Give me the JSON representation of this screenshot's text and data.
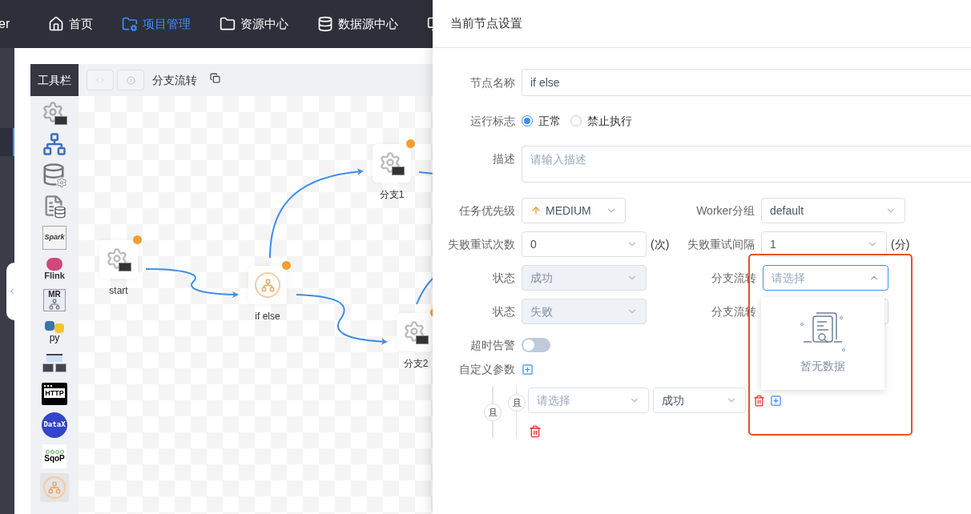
{
  "nav": {
    "logo_fragment": "er",
    "items": [
      {
        "label": "首页",
        "selected": false
      },
      {
        "label": "项目管理",
        "selected": true
      },
      {
        "label": "资源中心",
        "selected": false
      },
      {
        "label": "数据源中心",
        "selected": false
      }
    ]
  },
  "toolbar": {
    "title": "工具栏",
    "process_name": "分支流转"
  },
  "tools": [
    {
      "kind": "shell",
      "selected": false
    },
    {
      "kind": "subprocess",
      "selected": false
    },
    {
      "kind": "procedure",
      "selected": false
    },
    {
      "kind": "sql",
      "selected": false
    },
    {
      "kind": "spark",
      "label": "Spark",
      "selected": false
    },
    {
      "kind": "flink",
      "label": "Flink",
      "selected": false
    },
    {
      "kind": "mr",
      "label": "MR",
      "selected": false
    },
    {
      "kind": "python",
      "label": "py",
      "selected": false
    },
    {
      "kind": "dependent",
      "selected": false
    },
    {
      "kind": "http",
      "label": "HTTP",
      "selected": false
    },
    {
      "kind": "datax",
      "label": "DataX",
      "selected": false
    },
    {
      "kind": "sqoop",
      "label": "SqoP",
      "selected": false
    },
    {
      "kind": "conditions",
      "selected": true
    }
  ],
  "canvas": {
    "nodes": [
      {
        "label": "start",
        "kind": "shell"
      },
      {
        "label": "if else",
        "kind": "conditions"
      },
      {
        "label": "分支1",
        "kind": "shell"
      },
      {
        "label": "分支2",
        "kind": "shell"
      }
    ]
  },
  "drawer": {
    "title": "当前节点设置",
    "node_name": {
      "label": "节点名称",
      "value": "if else"
    },
    "run_flag": {
      "label": "运行标志",
      "options": [
        {
          "label": "正常",
          "selected": true
        },
        {
          "label": "禁止执行",
          "selected": false
        }
      ]
    },
    "description": {
      "label": "描述",
      "placeholder": "请输入描述"
    },
    "priority": {
      "label": "任务优先级",
      "value": "MEDIUM"
    },
    "worker_group": {
      "label": "Worker分组",
      "value": "default"
    },
    "retry_times": {
      "label": "失败重试次数",
      "value": "0",
      "unit": "(次)"
    },
    "retry_interval": {
      "label": "失败重试间隔",
      "value": "1",
      "unit": "(分)"
    },
    "branches": [
      {
        "state_label": "状态",
        "state": "成功",
        "flow_label": "分支流转",
        "flow_placeholder": "请选择",
        "open": true
      },
      {
        "state_label": "状态",
        "state": "失败",
        "flow_label": "分支流转",
        "open": false
      }
    ],
    "dropdown_empty": "暂无数据",
    "timeout_alarm": {
      "label": "超时告警",
      "on": false
    },
    "custom_params": {
      "label": "自定义参数"
    },
    "conditions": {
      "outer_op": "且",
      "groups": [
        {
          "op": "且",
          "items": [
            {
              "task_placeholder": "请选择",
              "state": "成功"
            }
          ]
        }
      ]
    }
  }
}
